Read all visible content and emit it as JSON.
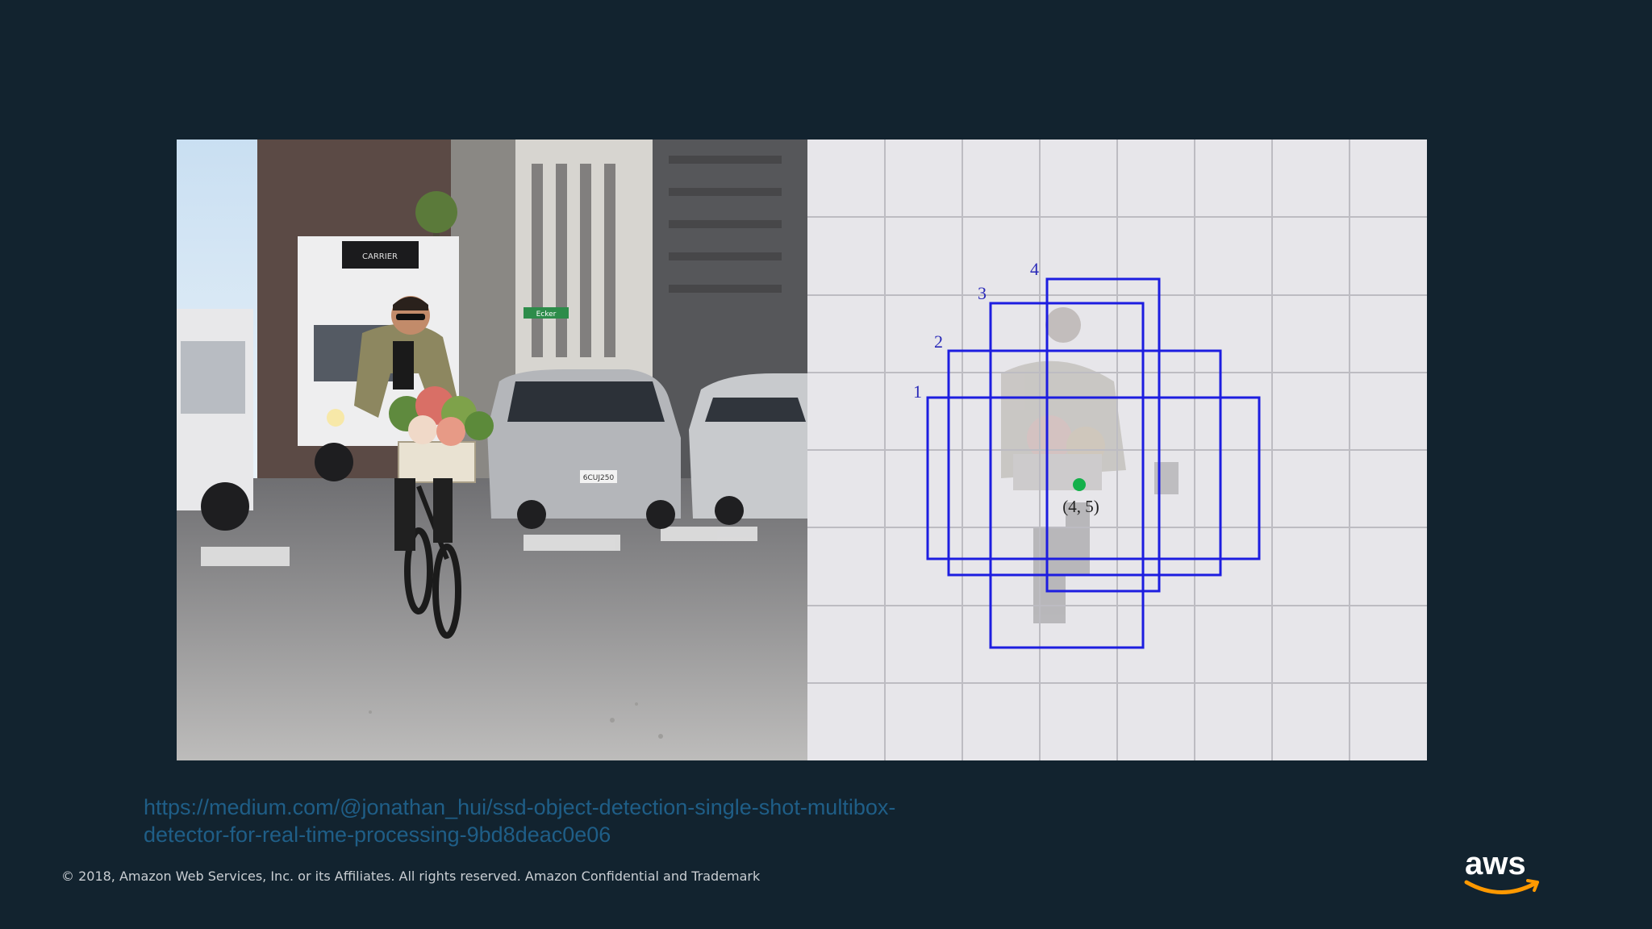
{
  "slide": {
    "background": "#12232f",
    "link_text": "https://medium.com/@jonathan_hui/ssd-object-detection-single-shot-multibox-detector-for-real-time-processing-9bd8deac0e06",
    "copyright": "© 2018, Amazon Web Services, Inc. or its Affiliates. All rights reserved. Amazon Confidential and Trademark",
    "logo_text": "aws"
  },
  "diagram": {
    "box_labels": [
      "1",
      "2",
      "3",
      "4"
    ],
    "cell_label": "(4, 5)",
    "box_color": "#1d1de0",
    "center_color": "#14b04a"
  },
  "photo": {
    "street_sign": "Ecker",
    "truck_label": "CARRIER",
    "plate": "6CUJ250"
  }
}
